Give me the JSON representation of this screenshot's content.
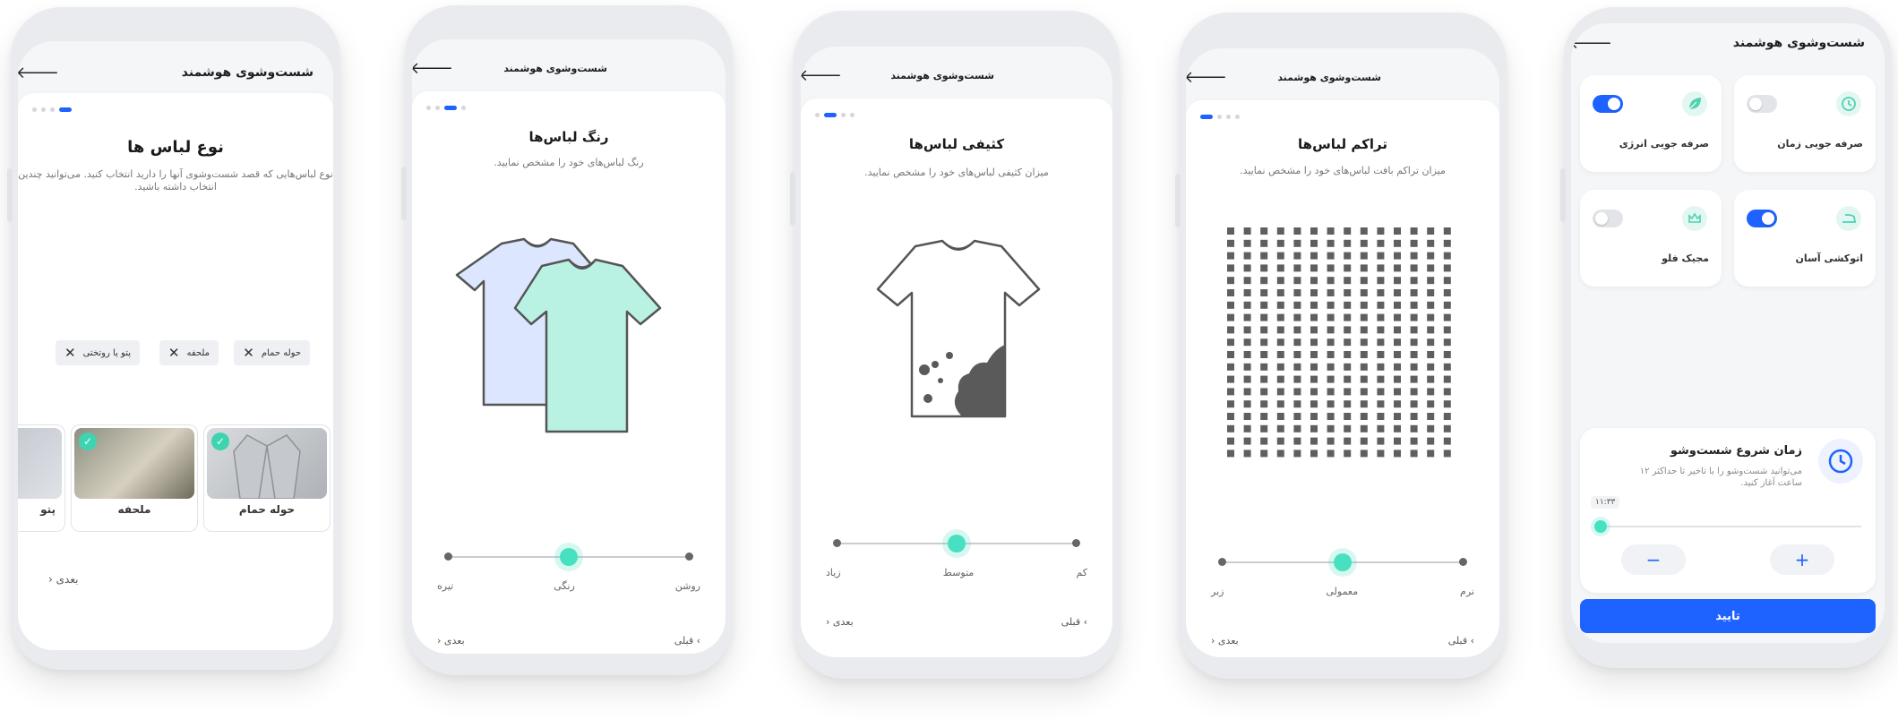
{
  "header_title": "شست‌وشوی هوشمند",
  "back_arrow": "🡐",
  "screen1": {
    "title": "نوع لباس ها",
    "subtitle": "نوع لباس‌هایی که قصد شست‌وشوی آنها را دارید انتخاب کنید. می‌توانید چندین انتخاب داشته باشید.",
    "chips": [
      "حوله حمام",
      "ملحفه",
      "پتو یا روتختی"
    ],
    "products": [
      {
        "label": "حوله حمام",
        "selected": true
      },
      {
        "label": "ملحفه",
        "selected": true
      },
      {
        "label": "پتو",
        "selected": false
      }
    ],
    "next": "بعدی"
  },
  "screen2": {
    "title": "رنگ لباس‌ها",
    "subtitle": "رنگ لباس‌های خود را مشخص نمایید.",
    "labels": [
      "روشن",
      "رنگی",
      "تیره"
    ],
    "level": 0.5,
    "prev": "قبلی",
    "next": "بعدی"
  },
  "screen3": {
    "title": "کثیفی لباس‌ها",
    "subtitle": "میزان کثیفی لباس‌های خود را مشخص نمایید.",
    "labels": [
      "کم",
      "متوسط",
      "زیاد"
    ],
    "level": 0.5,
    "prev": "قبلی",
    "next": "بعدی"
  },
  "screen4": {
    "title": "تراکم لباس‌ها",
    "subtitle": "میزان تراکم بافت لباس‌های خود را مشخص نمایید.",
    "labels": [
      "نرم",
      "معمولی",
      "زبر"
    ],
    "level": 0.5,
    "prev": "قبلی",
    "next": "بعدی"
  },
  "screen5": {
    "features": [
      {
        "label": "صرفه جویی زمان",
        "icon": "clock-icon",
        "on": false
      },
      {
        "label": "صرفه جویی انرژی",
        "icon": "leaf-icon",
        "on": true
      },
      {
        "label": "اتوکشی آسان",
        "icon": "iron-icon",
        "on": true
      },
      {
        "label": "مجیک فلو",
        "icon": "crown-icon",
        "on": false
      }
    ],
    "start": {
      "title": "زمان شروع شست‌وشو",
      "desc": "می‌توانید شست‌وشو را با تاخیر تا حداکثر ۱۲ ساعت آغاز کنید.",
      "time": "۱۱:۳۳",
      "level": 0.0
    },
    "minus": "−",
    "plus": "+",
    "confirm": "تایید"
  },
  "colors": {
    "accent": "#1e63ff",
    "mint": "#47e0c0",
    "lightblue": "#dce7ff",
    "mintshirt": "#b9f2e2"
  }
}
